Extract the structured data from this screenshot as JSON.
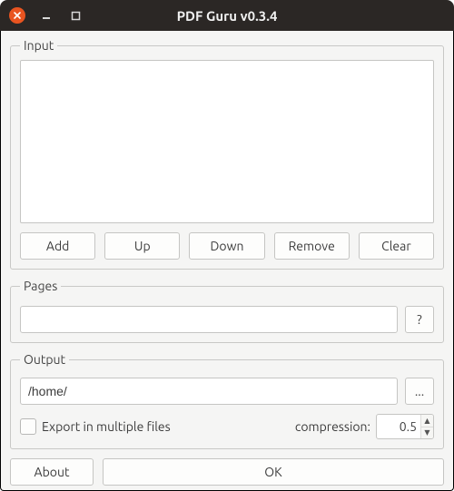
{
  "titlebar": {
    "title": "PDF Guru v0.3.4"
  },
  "input": {
    "legend": "Input",
    "buttons": {
      "add": "Add",
      "up": "Up",
      "down": "Down",
      "remove": "Remove",
      "clear": "Clear"
    }
  },
  "pages": {
    "legend": "Pages",
    "value": "",
    "help_label": "?"
  },
  "output": {
    "legend": "Output",
    "path": "/home/",
    "browse_label": "...",
    "export_multi_label": "Export in multiple files",
    "export_multi_checked": false,
    "compression_label": "compression:",
    "compression_value": "0.5"
  },
  "bottom": {
    "about": "About",
    "ok": "OK"
  }
}
